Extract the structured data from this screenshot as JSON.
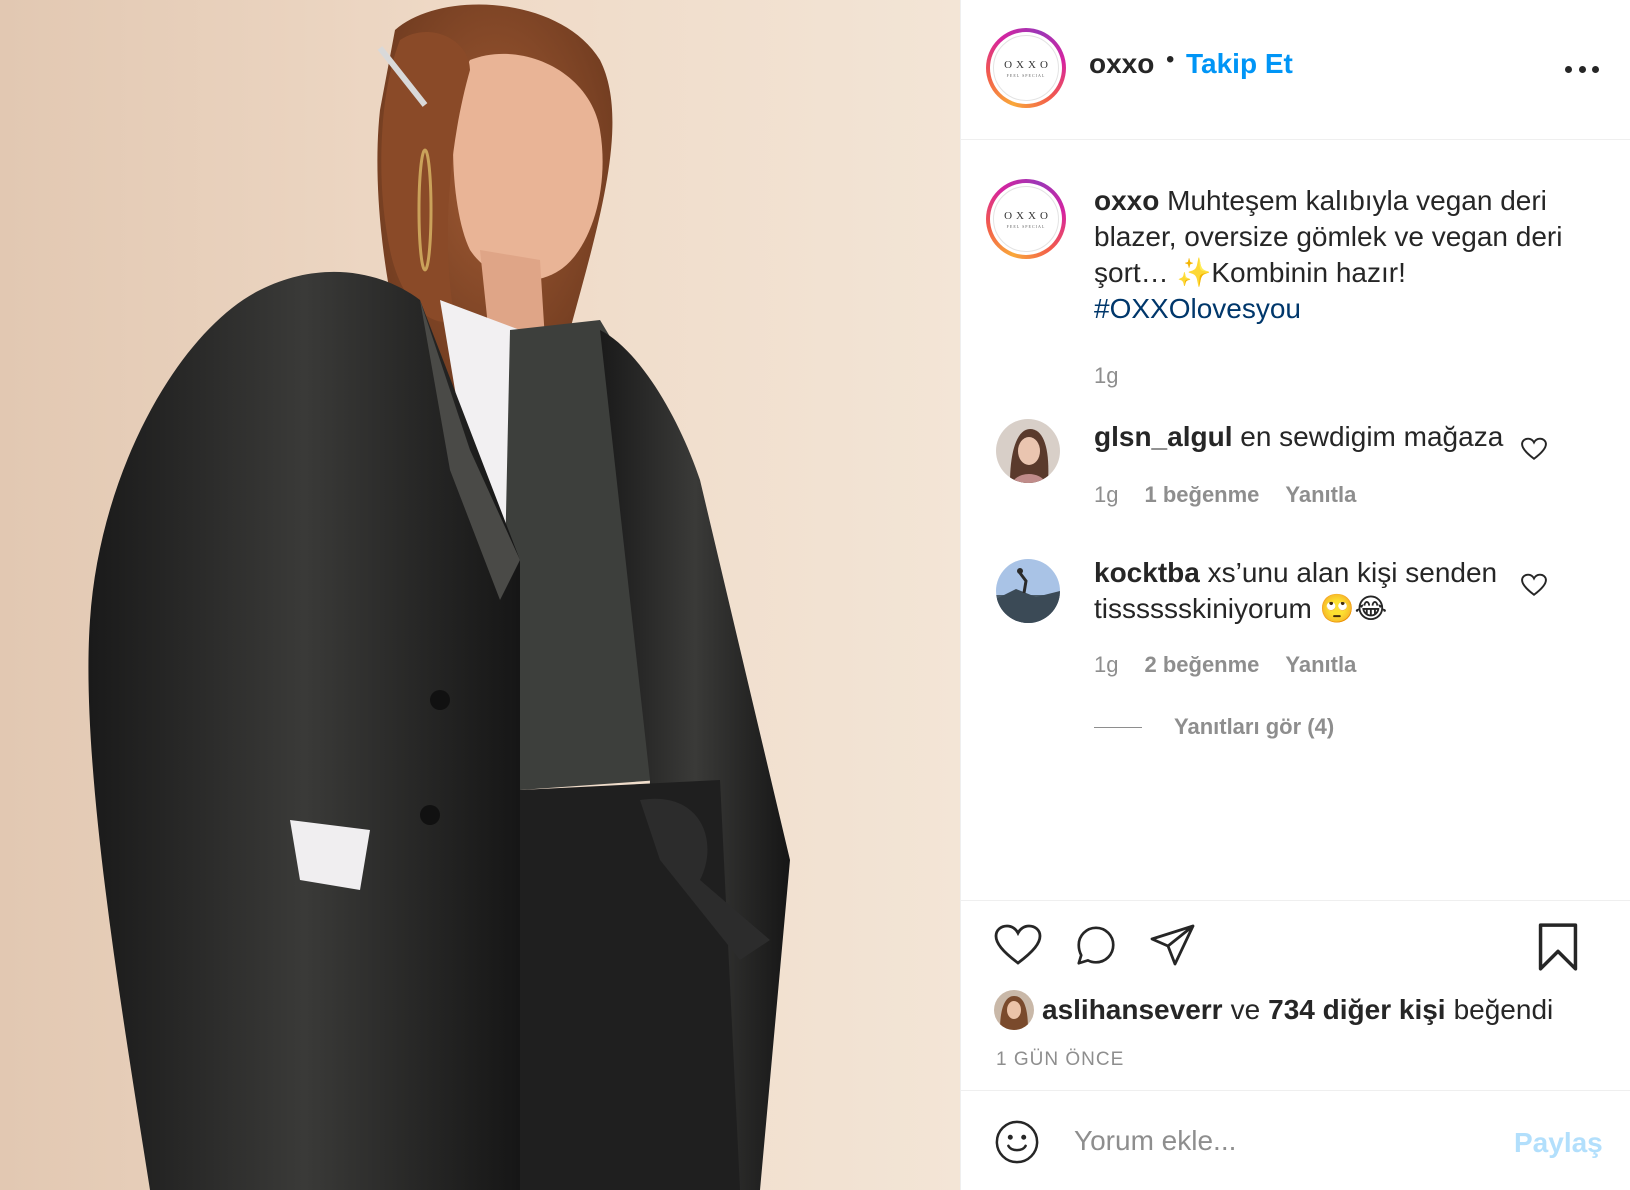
{
  "header": {
    "brand_logo_text": "OXXO",
    "brand_logo_sub": "FEEL SPECIAL",
    "username": "oxxo",
    "separator": "•",
    "follow_label": "Takip Et"
  },
  "caption": {
    "username": "oxxo",
    "text_before": "Muhteşem kalıbıyla vegan deri blazer, oversize gömlek ve vegan deri şort… ✨Kombinin hazır!",
    "hashtag": "#OXXOlovesyou",
    "time": "1g"
  },
  "comments": [
    {
      "username": "glsn_algul",
      "text": "en sewdigim mağaza",
      "time": "1g",
      "likes": "1 beğenme",
      "reply_label": "Yanıtla",
      "avatar_icon": "user-photo-woman"
    },
    {
      "username": "kocktba",
      "text": "xs’unu alan kişi senden tisssssskiniyorum 🙄😂",
      "time": "1g",
      "likes": "2 beğenme",
      "reply_label": "Yanıtla",
      "avatar_icon": "user-photo-landscape"
    }
  ],
  "replies_toggle": "Yanıtları gör (4)",
  "actions": {
    "icons": [
      "heart-icon",
      "comment-icon",
      "share-icon",
      "bookmark-icon"
    ],
    "liked_by_user": "aslihanseverr",
    "liked_by_connector": "ve",
    "liked_by_others": "734 diğer kişi",
    "liked_by_suffix": "beğendi",
    "date": "1 GÜN ÖNCE"
  },
  "add_comment": {
    "placeholder": "Yorum ekle...",
    "post_label": "Paylaş",
    "emoji_icon": "smiley-icon"
  },
  "colors": {
    "link_blue": "#0095f6",
    "hashtag_blue": "#00376b",
    "muted_gray": "#8e8e8e",
    "post_disabled": "#b2dffc"
  }
}
